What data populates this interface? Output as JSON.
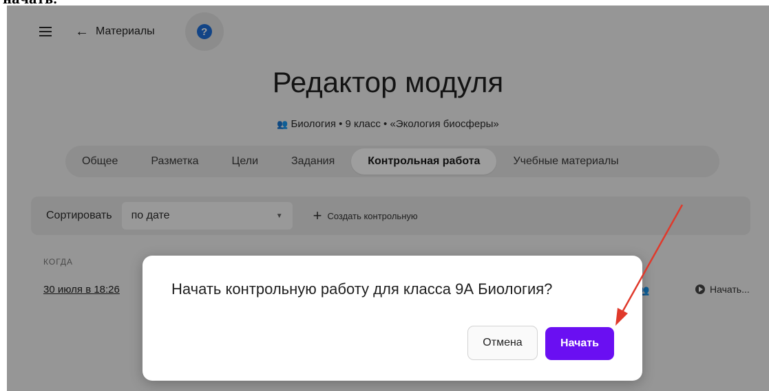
{
  "top_strip": "начать.",
  "topbar": {
    "back_label": "Материалы",
    "menu_icon": "hamburger-menu-icon",
    "back_icon": "arrow-left-icon",
    "help_icon": "help-icon"
  },
  "page": {
    "title": "Редактор модуля",
    "subtitle": "Биология • 9 класс • «Экология биосферы»",
    "subtitle_icon": "group-icon"
  },
  "tabs": [
    {
      "label": "Общее",
      "active": false
    },
    {
      "label": "Разметка",
      "active": false
    },
    {
      "label": "Цели",
      "active": false
    },
    {
      "label": "Задания",
      "active": false
    },
    {
      "label": "Контрольная работа",
      "active": true
    },
    {
      "label": "Учебные материалы",
      "active": false
    }
  ],
  "toolbar": {
    "sort_label": "Сортировать",
    "sort_value": "по дате",
    "create_label": "Создать контрольную"
  },
  "table": {
    "header_when": "КОГДА",
    "row": {
      "date": "30 июля в 18:26",
      "start_label": "Начать..."
    }
  },
  "dialog": {
    "text": "Начать контрольную работу для класса 9А Биология?",
    "cancel_label": "Отмена",
    "start_label": "Начать"
  },
  "colors": {
    "accent": "#6a0ff2",
    "help": "#1e6fd9",
    "annotation_arrow": "#e0392b"
  }
}
